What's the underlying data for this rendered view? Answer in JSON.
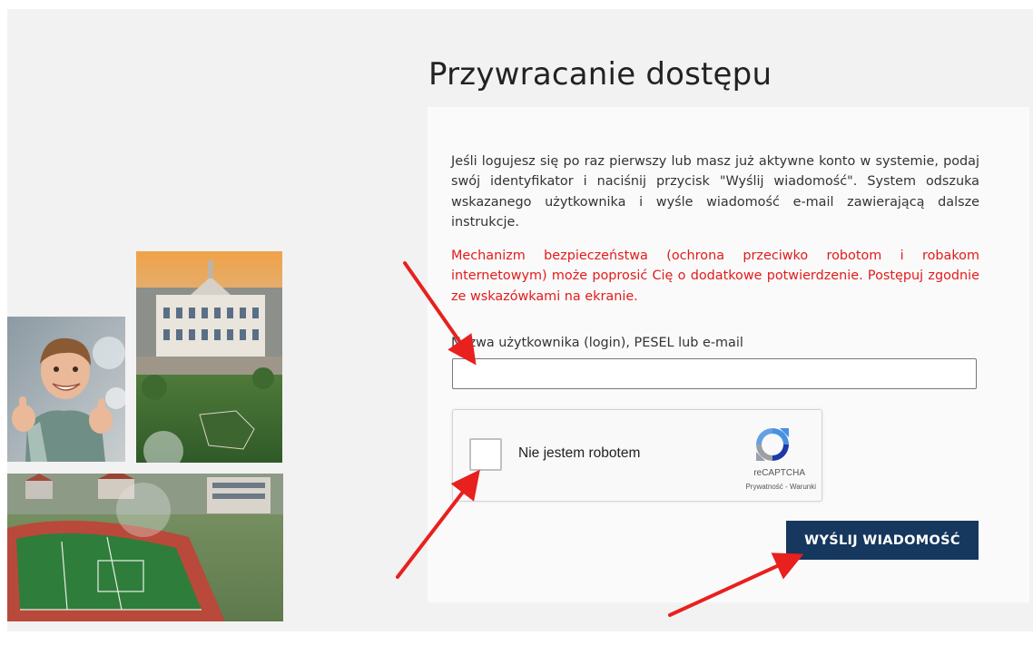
{
  "page": {
    "title": "Przywracanie dostępu"
  },
  "form": {
    "description": "Jeśli logujesz się po raz pierwszy lub masz już aktywne konto w systemie, podaj swój identyfikator i naciśnij przycisk \"Wyślij wiadomość\". System odszuka wskazanego użytkownika i wyśle wiadomość e-mail zawierającą dalsze instrukcje.",
    "warning": "Mechanizm bezpieczeństwa (ochrona przeciwko robotom i robakom internetowym) może poprosić Cię o dodatkowe potwierdzenie. Postępuj zgodnie ze wskazówkami na ekranie.",
    "login_label": "Nazwa użytkownika (login), PESEL lub e-mail",
    "login_value": "",
    "submit_label": "WYŚLIJ WIADOMOŚĆ"
  },
  "captcha": {
    "label": "Nie jestem robotem",
    "brand": "reCAPTCHA",
    "privacy": "Prywatność",
    "separator": "-",
    "terms": "Warunki",
    "icon": "recaptcha-logo-icon"
  },
  "colors": {
    "accent": "#16375e",
    "warning": "#e21b1b",
    "annotation_arrow": "#e8201e"
  }
}
